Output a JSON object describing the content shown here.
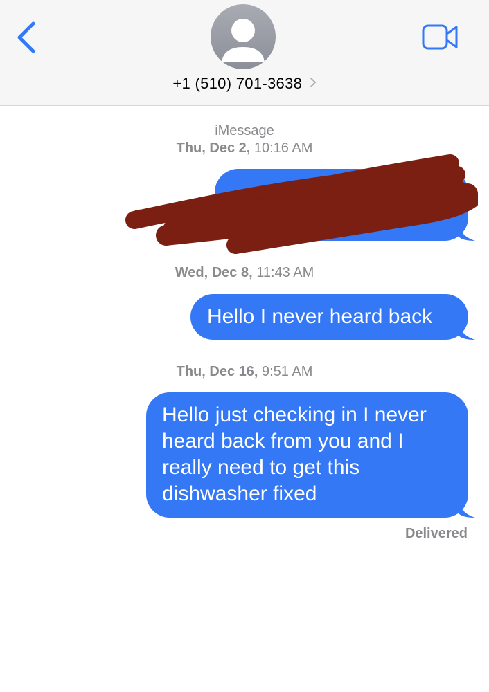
{
  "header": {
    "contact_name": "+1 (510) 701-3638",
    "back_icon": "chevron-left-icon",
    "video_icon": "video-camera-icon",
    "avatar_icon": "person-silhouette-icon"
  },
  "service_label": "iMessage",
  "messages": [
    {
      "timestamp_day": "Thu, Dec 2,",
      "timestamp_time": "10:16 AM",
      "text": "",
      "redacted": true
    },
    {
      "timestamp_day": "Wed, Dec 8,",
      "timestamp_time": "11:43 AM",
      "text": "Hello I never heard back"
    },
    {
      "timestamp_day": "Thu, Dec 16,",
      "timestamp_time": "9:51 AM",
      "text": "Hello just checking in I never heard back from you and I really need to get this dishwasher fixed"
    }
  ],
  "status": "Delivered",
  "colors": {
    "bubble": "#3478f6",
    "accent": "#3478f6",
    "redaction": "#7a1f12",
    "timestamp": "#8a8a8e"
  }
}
